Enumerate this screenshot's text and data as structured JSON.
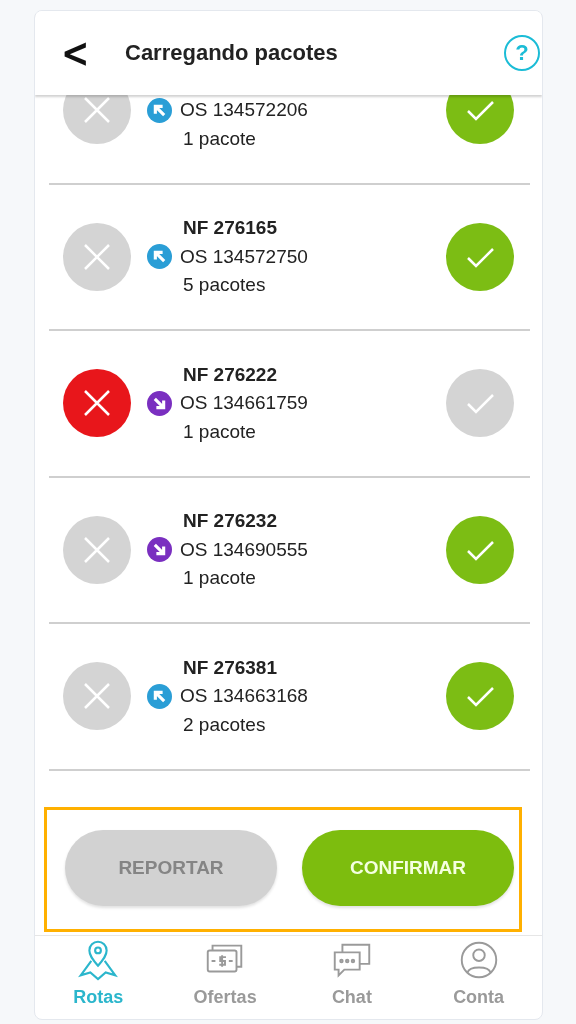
{
  "header": {
    "back": "<",
    "title": "Carregando pacotes",
    "help": "?"
  },
  "packages": [
    {
      "os": "OS 134572206",
      "count": "1 pacote",
      "kind": "pickup",
      "rejected": false,
      "confirmed": true
    },
    {
      "nf": "NF 276165",
      "os": "OS 134572750",
      "count": "5 pacotes",
      "kind": "pickup",
      "rejected": false,
      "confirmed": true
    },
    {
      "nf": "NF 276222",
      "os": "OS 134661759",
      "count": "1 pacote",
      "kind": "delivery",
      "rejected": true,
      "confirmed": false
    },
    {
      "nf": "NF 276232",
      "os": "OS 134690555",
      "count": "1 pacote",
      "kind": "delivery",
      "rejected": false,
      "confirmed": true
    },
    {
      "nf": "NF 276381",
      "os": "OS 134663168",
      "count": "2 pacotes",
      "kind": "pickup",
      "rejected": false,
      "confirmed": true
    }
  ],
  "actions": [
    {
      "label": "REPORTAR",
      "disabled": true
    },
    {
      "label": "CONFIRMAR",
      "disabled": false
    }
  ],
  "nav": [
    {
      "label": "Rotas",
      "kind": "routes",
      "selected": true
    },
    {
      "label": "Ofertas",
      "kind": "offers",
      "selected": false
    },
    {
      "label": "Chat",
      "kind": "chat",
      "selected": false
    },
    {
      "label": "Conta",
      "kind": "account",
      "selected": false
    }
  ]
}
